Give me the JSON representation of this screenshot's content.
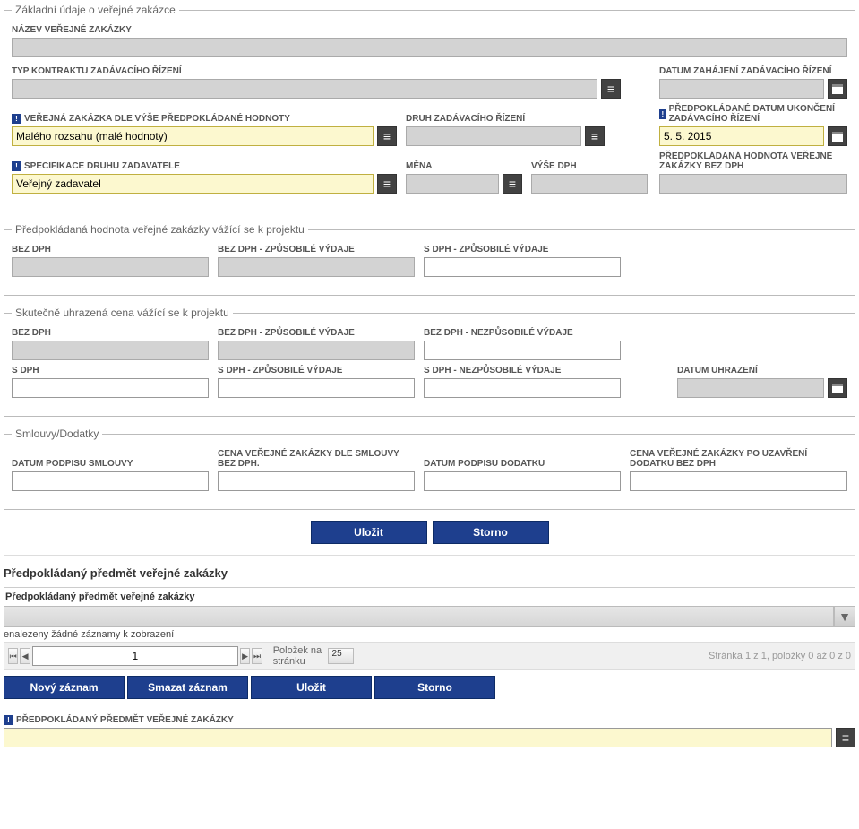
{
  "fieldset1": {
    "legend": "Základní údaje o veřejné zakázce",
    "name_label": "NÁZEV VEŘEJNÉ ZAKÁZKY",
    "contract_type_label": "TYP KONTRAKTU ZADÁVACÍHO ŘÍZENÍ",
    "start_date_label": "DATUM ZAHÁJENÍ ZADÁVACÍHO ŘÍZENÍ",
    "vz_by_value_label": "VEŘEJNÁ ZAKÁZKA DLE VÝŠE PŘEDPOKLÁDANÉ HODNOTY",
    "vz_by_value_value": "Malého rozsahu (malé hodnoty)",
    "proc_type_label": "DRUH ZADÁVACÍHO ŘÍZENÍ",
    "end_date_label": "PŘEDPOKLÁDANÉ DATUM UKONČENÍ ZADÁVACÍHO ŘÍZENÍ",
    "end_date_value": "5. 5. 2015",
    "authority_spec_label": "SPECIFIKACE DRUHU ZADAVATELE",
    "authority_spec_value": "Veřejný zadavatel",
    "currency_label": "MĚNA",
    "vat_rate_label": "VÝŠE DPH",
    "estimated_value_label": "PŘEDPOKLÁDANÁ HODNOTA VEŘEJNÉ ZAKÁZKY BEZ DPH"
  },
  "fieldset2": {
    "legend": "Předpokládaná hodnota veřejné zakázky vážící se k projektu",
    "f1": "BEZ DPH",
    "f2": "BEZ DPH - ZPŮSOBILÉ VÝDAJE",
    "f3": "S DPH - ZPŮSOBILÉ VÝDAJE"
  },
  "fieldset3": {
    "legend": "Skutečně uhrazená cena vážící se k projektu",
    "r1c1": "BEZ DPH",
    "r1c2": "BEZ DPH - ZPŮSOBILÉ VÝDAJE",
    "r1c3": "BEZ DPH - NEZPŮSOBILÉ VÝDAJE",
    "r2c1": "S DPH",
    "r2c2": "S DPH - ZPŮSOBILÉ VÝDAJE",
    "r2c3": "S DPH - NEZPŮSOBILÉ VÝDAJE",
    "r2c4": "DATUM UHRAZENÍ"
  },
  "fieldset4": {
    "legend": "Smlouvy/Dodatky",
    "c1": "DATUM PODPISU SMLOUVY",
    "c2": "CENA VEŘEJNÉ ZAKÁZKY DLE SMLOUVY BEZ DPH.",
    "c3": "DATUM PODPISU DODATKU",
    "c4": "CENA VEŘEJNÉ ZAKÁZKY PO UZAVŘENÍ DODATKU BEZ DPH"
  },
  "buttons": {
    "save": "Uložit",
    "cancel": "Storno",
    "new": "Nový záznam",
    "delete": "Smazat záznam"
  },
  "section2": {
    "title": "Předpokládaný předmět veřejné zakázky",
    "subheader": "Předpokládaný předmět veřejné zakázky",
    "norecords": "enalezeny žádné záznamy k zobrazení",
    "items_per_page_label": "Položek na stránku",
    "items_per_page_value": "25",
    "page_value": "1",
    "pager_info": "Stránka 1 z 1, položky 0 až 0 z 0",
    "bottom_label": "PŘEDPOKLÁDANÝ PŘEDMĚT VEŘEJNÉ ZAKÁZKY"
  }
}
